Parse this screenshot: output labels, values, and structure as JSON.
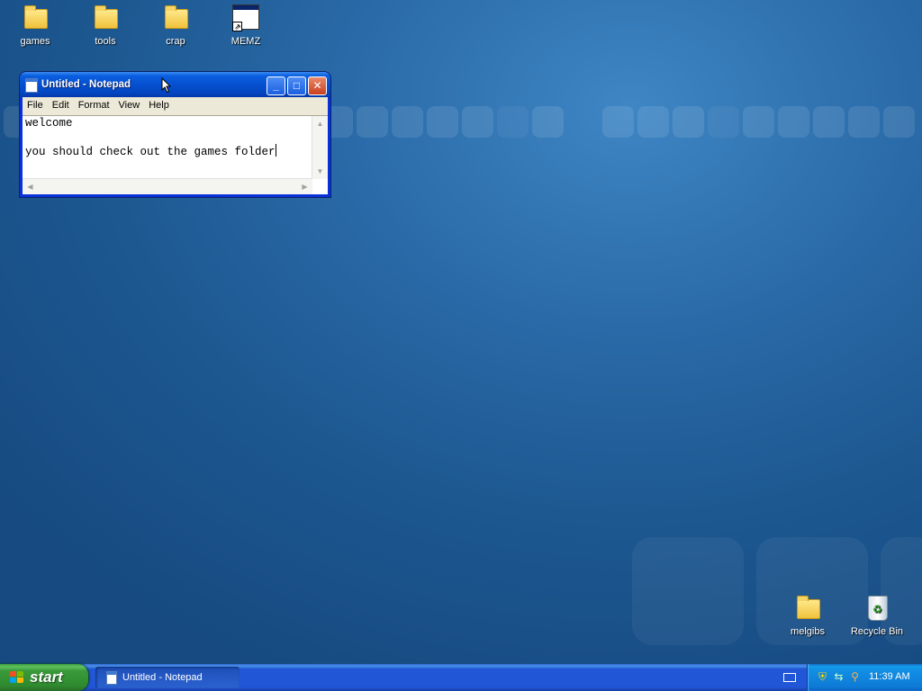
{
  "desktop": {
    "icons": [
      {
        "label": "games",
        "icon": "folder-icon"
      },
      {
        "label": "tools",
        "icon": "folder-icon"
      },
      {
        "label": "crap",
        "icon": "folder-icon"
      },
      {
        "label": "MEMZ",
        "icon": "app-shortcut-icon"
      },
      {
        "label": "melgibs",
        "icon": "folder-icon"
      },
      {
        "label": "Recycle Bin",
        "icon": "recycle-bin-icon"
      }
    ]
  },
  "notepad": {
    "title": "Untitled - Notepad",
    "menu": [
      "File",
      "Edit",
      "Format",
      "View",
      "Help"
    ],
    "lines": [
      "welcome",
      "you should check out the games folder"
    ]
  },
  "taskbar": {
    "start_label": "start",
    "tasks": [
      {
        "label": "Untitled - Notepad",
        "icon": "notepad-icon"
      }
    ],
    "tray_icons": [
      "keyboard-icon",
      "security-shield-icon",
      "network-icon",
      "search-icon"
    ],
    "clock": "11:39 AM"
  },
  "colors": {
    "title_bar": "#0550d0",
    "taskbar": "#2157d7",
    "start_button": "#3a9a3a",
    "tray": "#1290e6",
    "desktop": "#1d5891"
  }
}
